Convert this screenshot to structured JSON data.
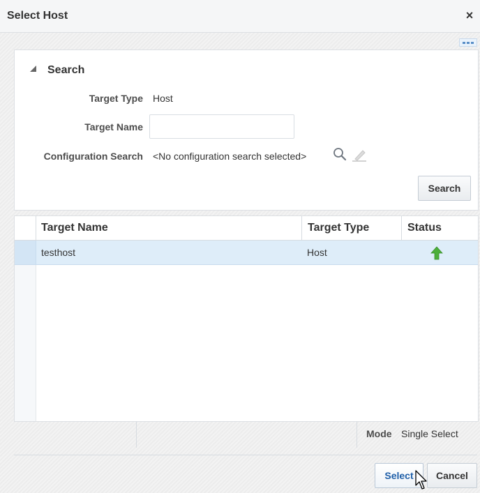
{
  "dialog": {
    "title": "Select Host",
    "close_glyph": "×"
  },
  "search": {
    "header": "Search",
    "target_type_label": "Target Type",
    "target_type_value": "Host",
    "target_name_label": "Target Name",
    "target_name_value": "",
    "config_search_label": "Configuration Search",
    "config_search_value": "<No configuration search selected>",
    "search_button": "Search"
  },
  "table": {
    "columns": [
      "Target Name",
      "Target Type",
      "Status"
    ],
    "rows": [
      {
        "target_name": "testhost",
        "target_type": "Host",
        "status": "up-arrow-icon"
      }
    ]
  },
  "footer": {
    "mode_label": "Mode",
    "mode_value": "Single Select"
  },
  "buttons": {
    "select": "Select",
    "cancel": "Cancel"
  },
  "colors": {
    "accent": "#1f5fa8",
    "selected_row": "#deedf9",
    "status_up": "#4caf3a"
  }
}
